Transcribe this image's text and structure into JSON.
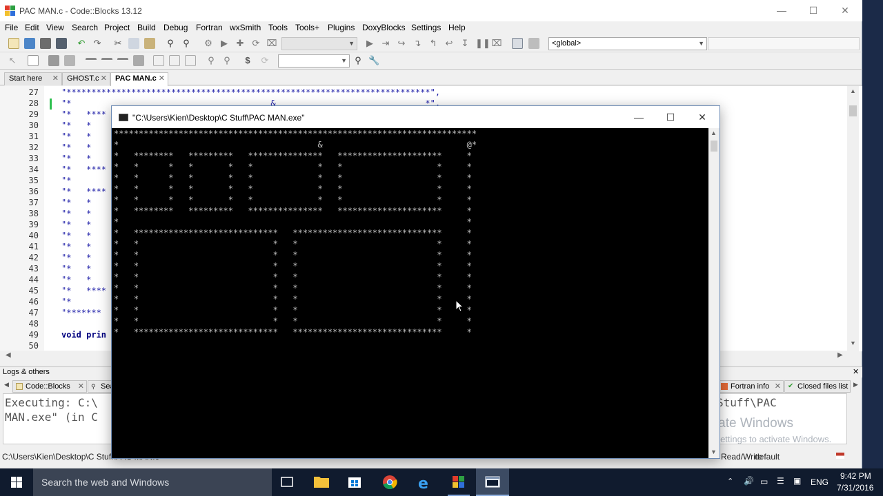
{
  "window": {
    "title": "PAC MAN.c - Code::Blocks 13.12"
  },
  "menu": [
    "File",
    "Edit",
    "View",
    "Search",
    "Project",
    "Build",
    "Debug",
    "Fortran",
    "wxSmith",
    "Tools",
    "Tools+",
    "Plugins",
    "DoxyBlocks",
    "Settings",
    "Help"
  ],
  "toolbar": {
    "scope_combo": "<global>"
  },
  "editor_tabs": [
    {
      "label": "Start here"
    },
    {
      "label": "GHOST.c"
    },
    {
      "label": "PAC MAN.c"
    }
  ],
  "editor": {
    "lines": [
      {
        "num": "27",
        "text": "\"*************************************************************************\","
      },
      {
        "num": "28",
        "text": "\"*                                        &                              *\","
      },
      {
        "num": "29",
        "text": "\"*   ****"
      },
      {
        "num": "30",
        "text": "\"*   *"
      },
      {
        "num": "31",
        "text": "\"*   *"
      },
      {
        "num": "32",
        "text": "\"*   *"
      },
      {
        "num": "33",
        "text": "\"*   *"
      },
      {
        "num": "34",
        "text": "\"*   ****"
      },
      {
        "num": "35",
        "text": "\"*"
      },
      {
        "num": "36",
        "text": "\"*   ****"
      },
      {
        "num": "37",
        "text": "\"*   *"
      },
      {
        "num": "38",
        "text": "\"*   *"
      },
      {
        "num": "39",
        "text": "\"*   *"
      },
      {
        "num": "40",
        "text": "\"*   *"
      },
      {
        "num": "41",
        "text": "\"*   *"
      },
      {
        "num": "42",
        "text": "\"*   *"
      },
      {
        "num": "43",
        "text": "\"*   *"
      },
      {
        "num": "44",
        "text": "\"*   *"
      },
      {
        "num": "45",
        "text": "\"*   ****"
      },
      {
        "num": "46",
        "text": "\"*"
      },
      {
        "num": "47",
        "text": "\"*******"
      },
      {
        "num": "48",
        "text": ""
      },
      {
        "num": "49",
        "text": "void prin"
      },
      {
        "num": "50",
        "text": ""
      }
    ]
  },
  "logs": {
    "header": "Logs & others",
    "tabs": [
      {
        "label": "Code::Blocks"
      },
      {
        "label": "Sea"
      },
      {
        "label": "Fortran info"
      },
      {
        "label": "Closed files list"
      }
    ],
    "line1_left": "Executing: C:\\",
    "line1_right": "Stuff\\PAC",
    "line2_left": "MAN.exe\" (in C"
  },
  "statusbar": {
    "path": "C:\\Users\\Kien\\Desktop\\C Stuff\\PAC MAN.c",
    "mode": "Read/Write",
    "profile": "default"
  },
  "watermark": {
    "line1": "Activate Windows",
    "line2": "Go to Settings to activate Windows."
  },
  "console": {
    "title": "\"C:\\Users\\Kien\\Desktop\\C Stuff\\PAC MAN.exe\"",
    "screen": [
      "*************************************************************************",
      "*                                        &                             @*",
      "*   ********   *********   ***************   *********************     *",
      "*   *      *   *       *   *             *   *                   *     *",
      "*   *      *   *       *   *             *   *                   *     *",
      "*   *      *   *       *   *             *   *                   *     *",
      "*   *      *   *       *   *             *   *                   *     *",
      "*   ********   *********   ***************   *********************     *",
      "*                                                                      *",
      "*   *****************************   ******************************     *",
      "*   *                           *   *                            *     *",
      "*   *                           *   *                            *     *",
      "*   *                           *   *                            *     *",
      "*   *                           *   *                            *     *",
      "*   *                           *   *                            *     *",
      "*   *                           *   *                            *     *",
      "*   *                           *   *                            *     *",
      "*   *                           *   *                            *     *",
      "*   *****************************   ******************************     *"
    ]
  },
  "taskbar": {
    "search_placeholder": "Search the web and Windows",
    "language": "ENG",
    "time": "9:42 PM",
    "date": "7/31/2016"
  },
  "colors": {
    "taskbar": "#101b2e",
    "console_bg": "#000000",
    "console_text": "#c0c0c0",
    "code_string": "#1a1aa6"
  }
}
